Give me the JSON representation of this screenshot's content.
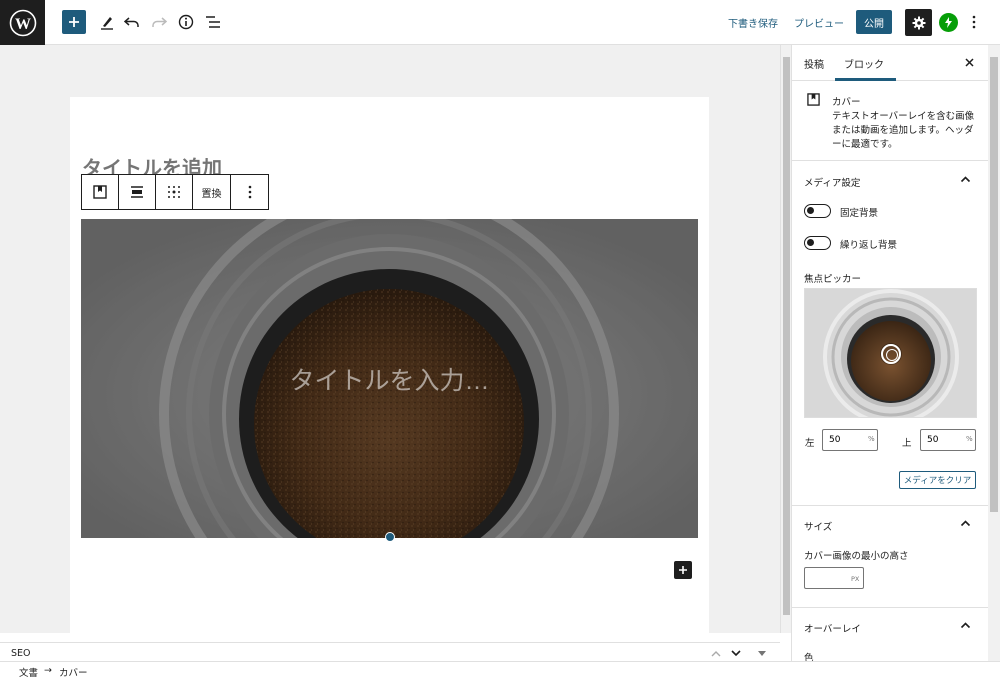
{
  "topbar": {
    "draft_label": "下書き保存",
    "preview_label": "プレビュー",
    "publish_label": "公開"
  },
  "editor": {
    "post_title_placeholder": "タイトルを追加",
    "toolbar": {
      "replace_label": "置換"
    },
    "cover_title_placeholder": "タイトルを入力…"
  },
  "sidebar": {
    "tabs": [
      "投稿",
      "ブロック"
    ],
    "active_tab": "ブロック",
    "block_card": {
      "title": "カバー",
      "description": "テキストオーバーレイを含む画像または動画を追加します。ヘッダーに最適です。"
    },
    "media_panel": {
      "title": "メディア設定",
      "fixed_bg_label": "固定背景",
      "repeat_bg_label": "繰り返し背景",
      "focal_picker_label": "焦点ピッカー",
      "left_label": "左",
      "left_value": "50",
      "top_label": "上",
      "top_value": "50",
      "unit": "%",
      "clear_media_label": "メディアをクリア"
    },
    "size_panel": {
      "title": "サイズ",
      "min_height_label": "カバー画像の最小の高さ",
      "unit": "PX"
    },
    "overlay_panel": {
      "title": "オーバーレイ",
      "color_label": "色"
    }
  },
  "bottom": {
    "seo_label": "SEO",
    "breadcrumb": [
      "文書",
      "→",
      "カバー"
    ]
  },
  "colors": {
    "accent": "#1e5b7c",
    "dark": "#1e1e1e",
    "jetpack": "#069e08"
  }
}
